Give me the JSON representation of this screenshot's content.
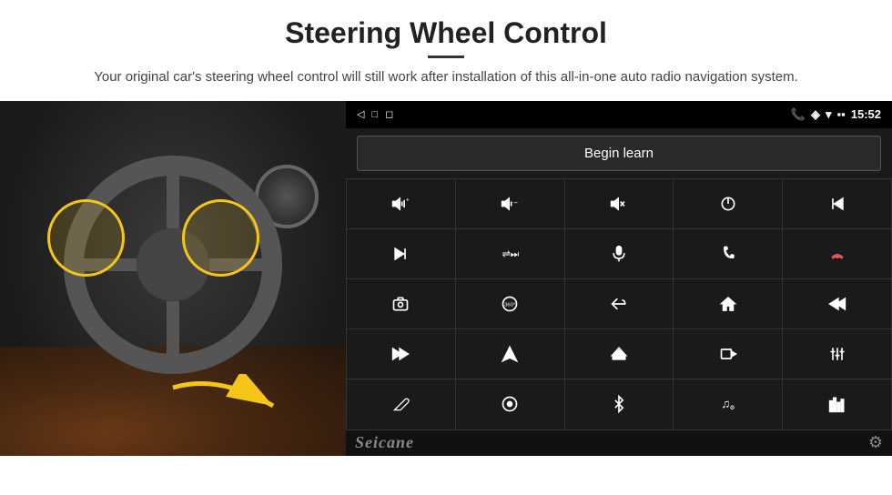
{
  "header": {
    "title": "Steering Wheel Control",
    "subtitle": "Your original car's steering wheel control will still work after installation of this all-in-one auto radio navigation system."
  },
  "status_bar": {
    "time": "15:52",
    "nav_back": "◁",
    "nav_home": "□",
    "nav_recents": "◻"
  },
  "begin_learn_label": "Begin learn",
  "controls": [
    {
      "icon": "vol-up",
      "symbol": "🔊+"
    },
    {
      "icon": "vol-down",
      "symbol": "🔊−"
    },
    {
      "icon": "mute",
      "symbol": "🔇"
    },
    {
      "icon": "power",
      "symbol": "⏻"
    },
    {
      "icon": "prev-track",
      "symbol": "⏮"
    },
    {
      "icon": "next",
      "symbol": "⏭"
    },
    {
      "icon": "shuffle",
      "symbol": "⇌⏭"
    },
    {
      "icon": "mic",
      "symbol": "🎤"
    },
    {
      "icon": "phone",
      "symbol": "📞"
    },
    {
      "icon": "hang-up",
      "symbol": "📵"
    },
    {
      "icon": "camera",
      "symbol": "📷"
    },
    {
      "icon": "360-view",
      "symbol": "👁360"
    },
    {
      "icon": "back",
      "symbol": "↩"
    },
    {
      "icon": "home",
      "symbol": "⌂"
    },
    {
      "icon": "skip-back",
      "symbol": "⏮⏮"
    },
    {
      "icon": "fast-forward",
      "symbol": "⏩"
    },
    {
      "icon": "navigate",
      "symbol": "➤"
    },
    {
      "icon": "eject",
      "symbol": "⏏"
    },
    {
      "icon": "record",
      "symbol": "⏺"
    },
    {
      "icon": "equalizer",
      "symbol": "⫿"
    },
    {
      "icon": "pen",
      "symbol": "✏"
    },
    {
      "icon": "circle-dot",
      "symbol": "◎"
    },
    {
      "icon": "bluetooth",
      "symbol": "✦"
    },
    {
      "icon": "music-note",
      "symbol": "♫"
    },
    {
      "icon": "bars",
      "symbol": "|||"
    }
  ],
  "branding": {
    "name": "Seicane"
  },
  "colors": {
    "background": "#ffffff",
    "panel_bg": "#1a1a1a",
    "status_bar_bg": "#000000",
    "button_bg": "#1a1a1a",
    "button_border": "#555555",
    "text_primary": "#ffffff",
    "highlight_yellow": "#f5c518"
  }
}
